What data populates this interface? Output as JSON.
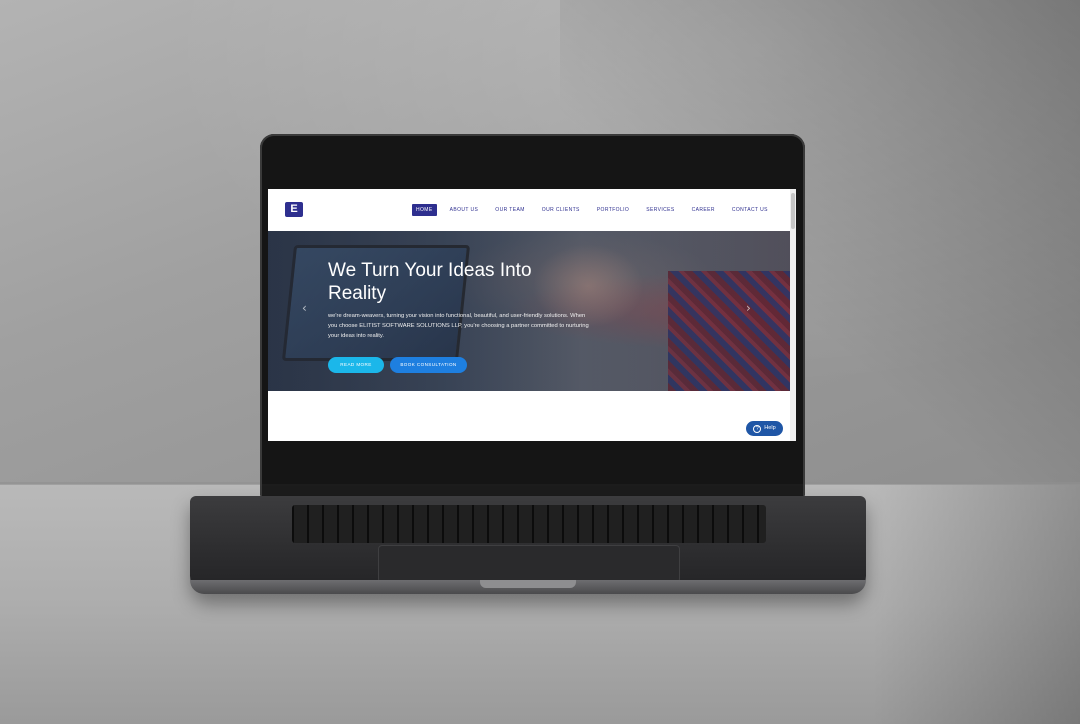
{
  "site": {
    "logo_letter": "E",
    "nav": [
      {
        "label": "HOME",
        "active": true
      },
      {
        "label": "ABOUT US"
      },
      {
        "label": "OUR TEAM"
      },
      {
        "label": "OUR CLIENTS"
      },
      {
        "label": "PORTFOLIO"
      },
      {
        "label": "SERVICES"
      },
      {
        "label": "CAREER"
      },
      {
        "label": "CONTACT US"
      }
    ],
    "hero": {
      "title": "We Turn Your Ideas Into Reality",
      "text": "we're dream-weavers, turning your vision into functional, beautiful, and user-friendly solutions. When you choose ELITIST SOFTWARE SOLUTIONS LLP, you're choosing a partner committed to nurturing your ideas into reality.",
      "read_more_label": "READ MORE",
      "book_label": "BOOK CONSULTATION",
      "prev_arrow": "‹",
      "next_arrow": "›"
    },
    "help": {
      "icon_glyph": "?",
      "label": "Help"
    }
  },
  "colors": {
    "brand": "#2e2f8f",
    "read_more": "#1bb7ea",
    "book": "#1e7fe0",
    "help": "#1f56a6"
  }
}
